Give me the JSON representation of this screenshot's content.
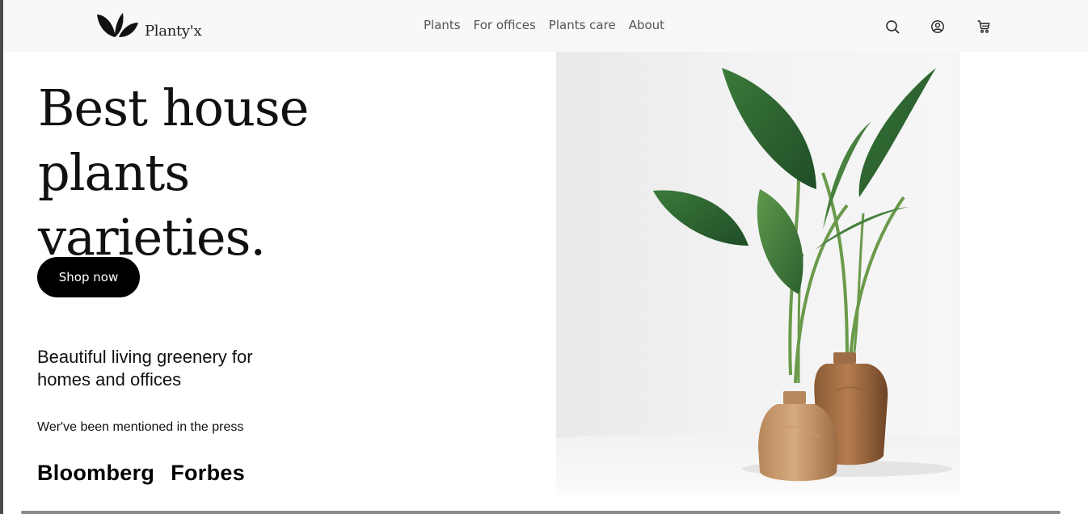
{
  "brand": {
    "name": "Planty'x"
  },
  "nav": {
    "links": [
      "Plants",
      "For offices",
      "Plants care",
      "About"
    ],
    "icons": [
      "search-icon",
      "user-icon",
      "cart-icon"
    ]
  },
  "hero": {
    "title": "Best house plants varieties.",
    "cta_label": "Shop now",
    "subtitle": "Beautiful living greenery for homes and offices",
    "press_label": "Wer've been mentioned in the press",
    "press_logos": [
      "Bloomberg",
      "Forbes"
    ]
  },
  "colors": {
    "navbar_bg": "#f7f8f9",
    "button_bg": "#000000",
    "text": "#111111"
  }
}
